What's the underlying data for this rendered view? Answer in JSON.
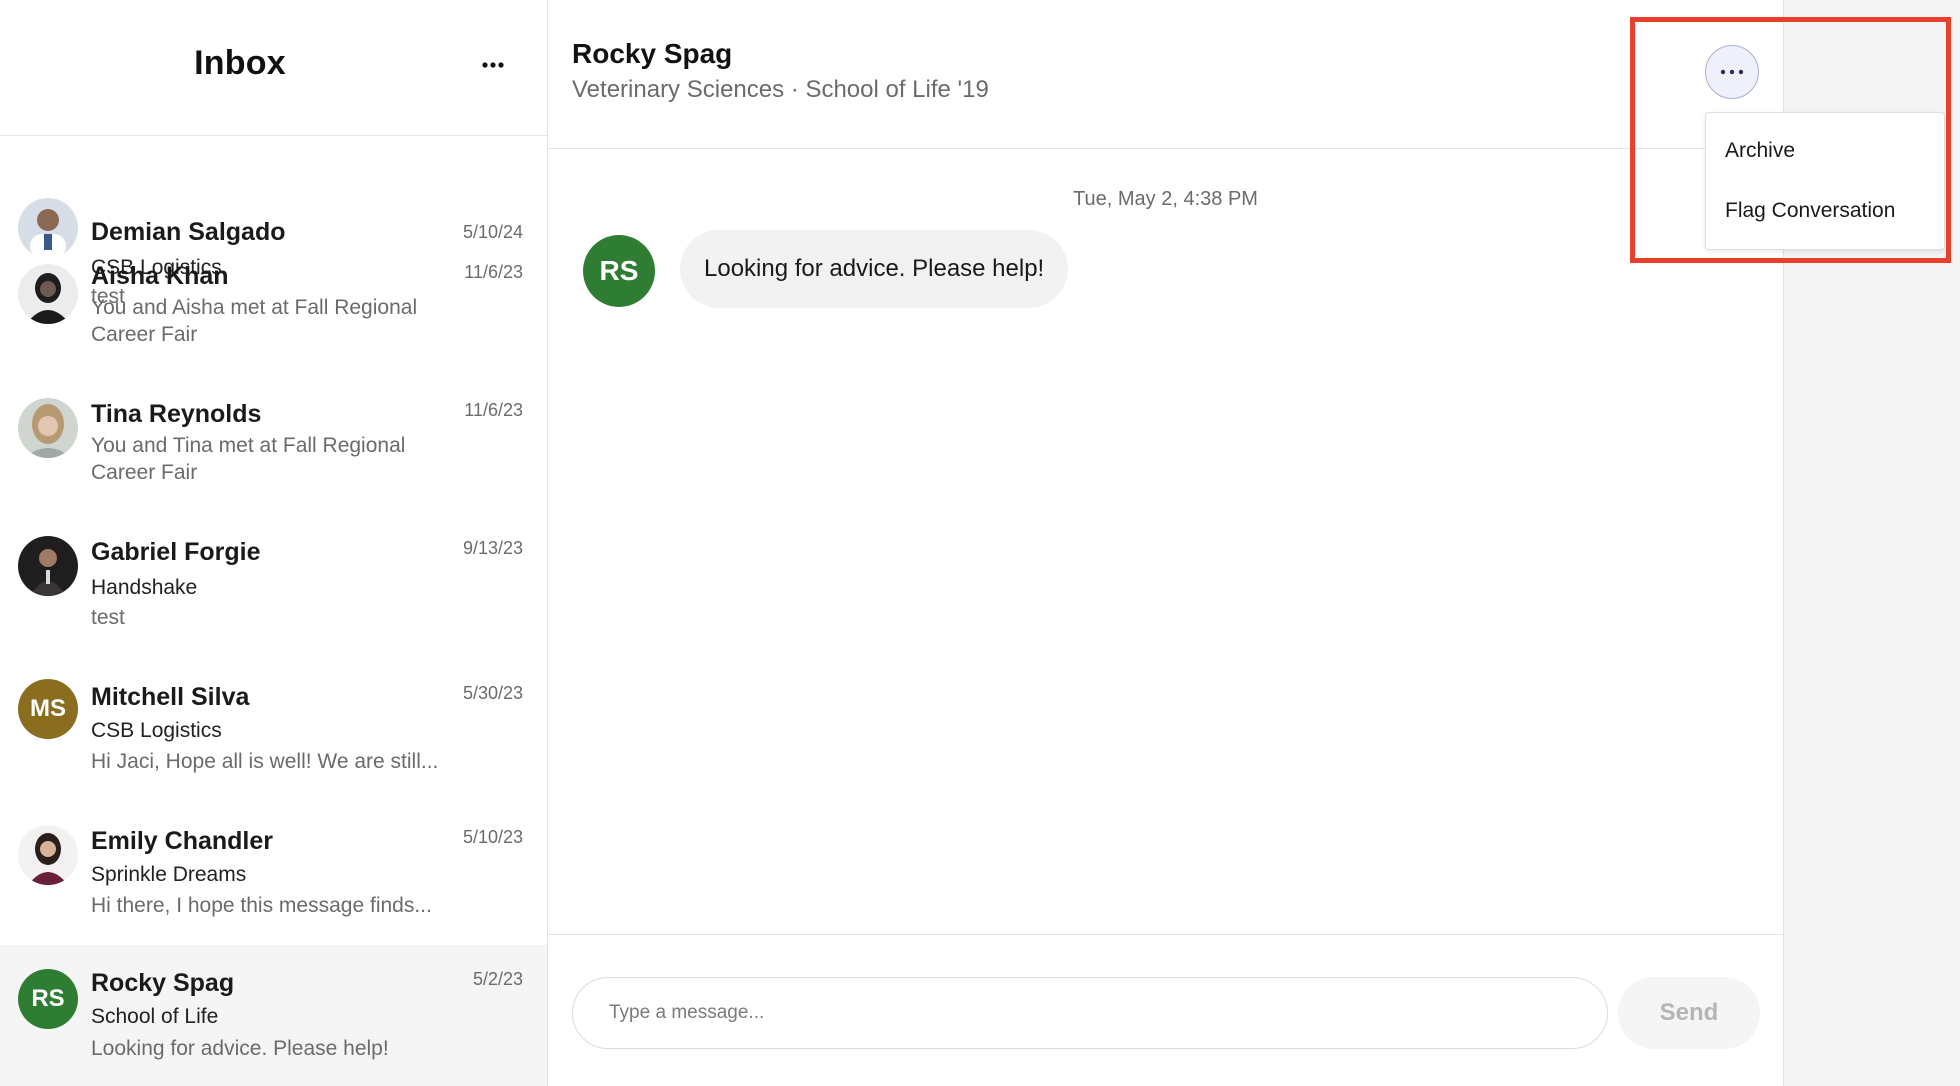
{
  "sidebar": {
    "title": "Inbox",
    "more_icon": "ellipsis-icon",
    "conversations": [
      {
        "name": "Demian Salgado",
        "date": "5/10/24",
        "line": "CSB Logistics",
        "preview": "test",
        "avatar_initials": "",
        "avatar_icon": "person-photo-icon"
      },
      {
        "name": "Aisha Khan",
        "date": "11/6/23",
        "line": "",
        "preview": "You and Aisha met at Fall Regional Career Fair",
        "avatar_initials": "",
        "avatar_icon": "person-photo-icon"
      },
      {
        "name": "Tina Reynolds",
        "date": "11/6/23",
        "line": "",
        "preview": "You and Tina met at Fall Regional Career Fair",
        "avatar_initials": "",
        "avatar_icon": "person-photo-icon"
      },
      {
        "name": "Gabriel Forgie",
        "date": "9/13/23",
        "line": "Handshake",
        "preview": "test",
        "avatar_initials": "",
        "avatar_icon": "person-photo-icon"
      },
      {
        "name": "Mitchell Silva",
        "date": "5/30/23",
        "line": "CSB Logistics",
        "preview": "Hi Jaci, Hope all is well! We are still...",
        "avatar_initials": "MS",
        "avatar_color": "#8a6d1e"
      },
      {
        "name": "Emily Chandler",
        "date": "5/10/23",
        "line": "Sprinkle Dreams",
        "preview": "Hi there, I hope this message finds...",
        "avatar_initials": "",
        "avatar_icon": "person-photo-icon"
      },
      {
        "name": "Rocky Spag",
        "date": "5/2/23",
        "line": "School of Life",
        "preview": "Looking for advice. Please help!",
        "avatar_initials": "RS",
        "avatar_color": "#2f7d32",
        "active": true
      }
    ]
  },
  "thread": {
    "contact_name": "Rocky Spag",
    "contact_subtitle": "Veterinary Sciences · School of Life '19",
    "more_icon": "ellipsis-icon",
    "timestamp": "Tue, May 2, 4:38 PM",
    "messages": [
      {
        "sender_initials": "RS",
        "text": "Looking for advice. Please help!",
        "avatar_color": "#2f7d32"
      }
    ]
  },
  "composer": {
    "placeholder": "Type a message...",
    "value": "",
    "send_label": "Send"
  },
  "menu": {
    "items": [
      "Archive",
      "Flag Conversation"
    ]
  },
  "colors": {
    "accent_green": "#2f7d32",
    "accent_gold": "#8a6d1e",
    "highlight_red": "#e8412b",
    "more_button_bg": "#eef0fb"
  }
}
